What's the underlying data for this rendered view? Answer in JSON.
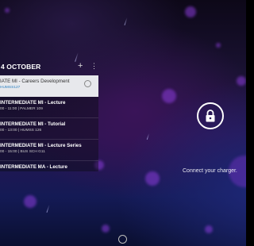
{
  "calendar": {
    "date_header": "4 OCTOBER",
    "add_icon": "plus-icon",
    "menu_icon": "overflow-menu-icon",
    "events": [
      {
        "title": "IATE MI - Careers Development",
        "meta": "HUMSS127",
        "highlighted": true
      },
      {
        "title": "INTERMEDIATE MI - Lecture",
        "meta": "00 - 11:00 | PALMER 109",
        "highlighted": false
      },
      {
        "title": "INTERMEDIATE MI - Tutorial",
        "meta": "00 - 13:00 | HUMSS 126",
        "highlighted": false
      },
      {
        "title": "INTERMEDIATE MI - Lecture Series",
        "meta": "00 - 15:00 | BUS SCH G11",
        "highlighted": false
      },
      {
        "title": "INTERMEDIATE MA - Lecture",
        "meta": "",
        "highlighted": false
      }
    ]
  },
  "lockscreen": {
    "lock_icon": "lock-icon",
    "charger_message": "Connect your charger."
  },
  "nav": {
    "home_icon": "home-circle-icon"
  },
  "colors": {
    "highlight_bg": "#e7e8ec",
    "meta_link": "#2a7fc0",
    "bokeh": "#8c3cdc"
  }
}
